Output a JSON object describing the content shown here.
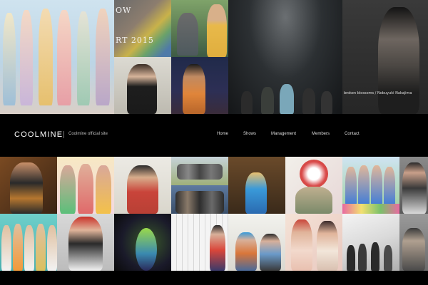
{
  "header": {
    "brand": "COOLMINE",
    "tagline": "Coolmine official site"
  },
  "nav": {
    "items": [
      "Home",
      "Shows",
      "Management",
      "Members",
      "Contact"
    ]
  },
  "tiles": {
    "top_poster_text_1": "OW",
    "top_poster_text_2": "RT 2015",
    "nakajima_caption": "broken blossoms / Nobuyuki Nakajima"
  }
}
